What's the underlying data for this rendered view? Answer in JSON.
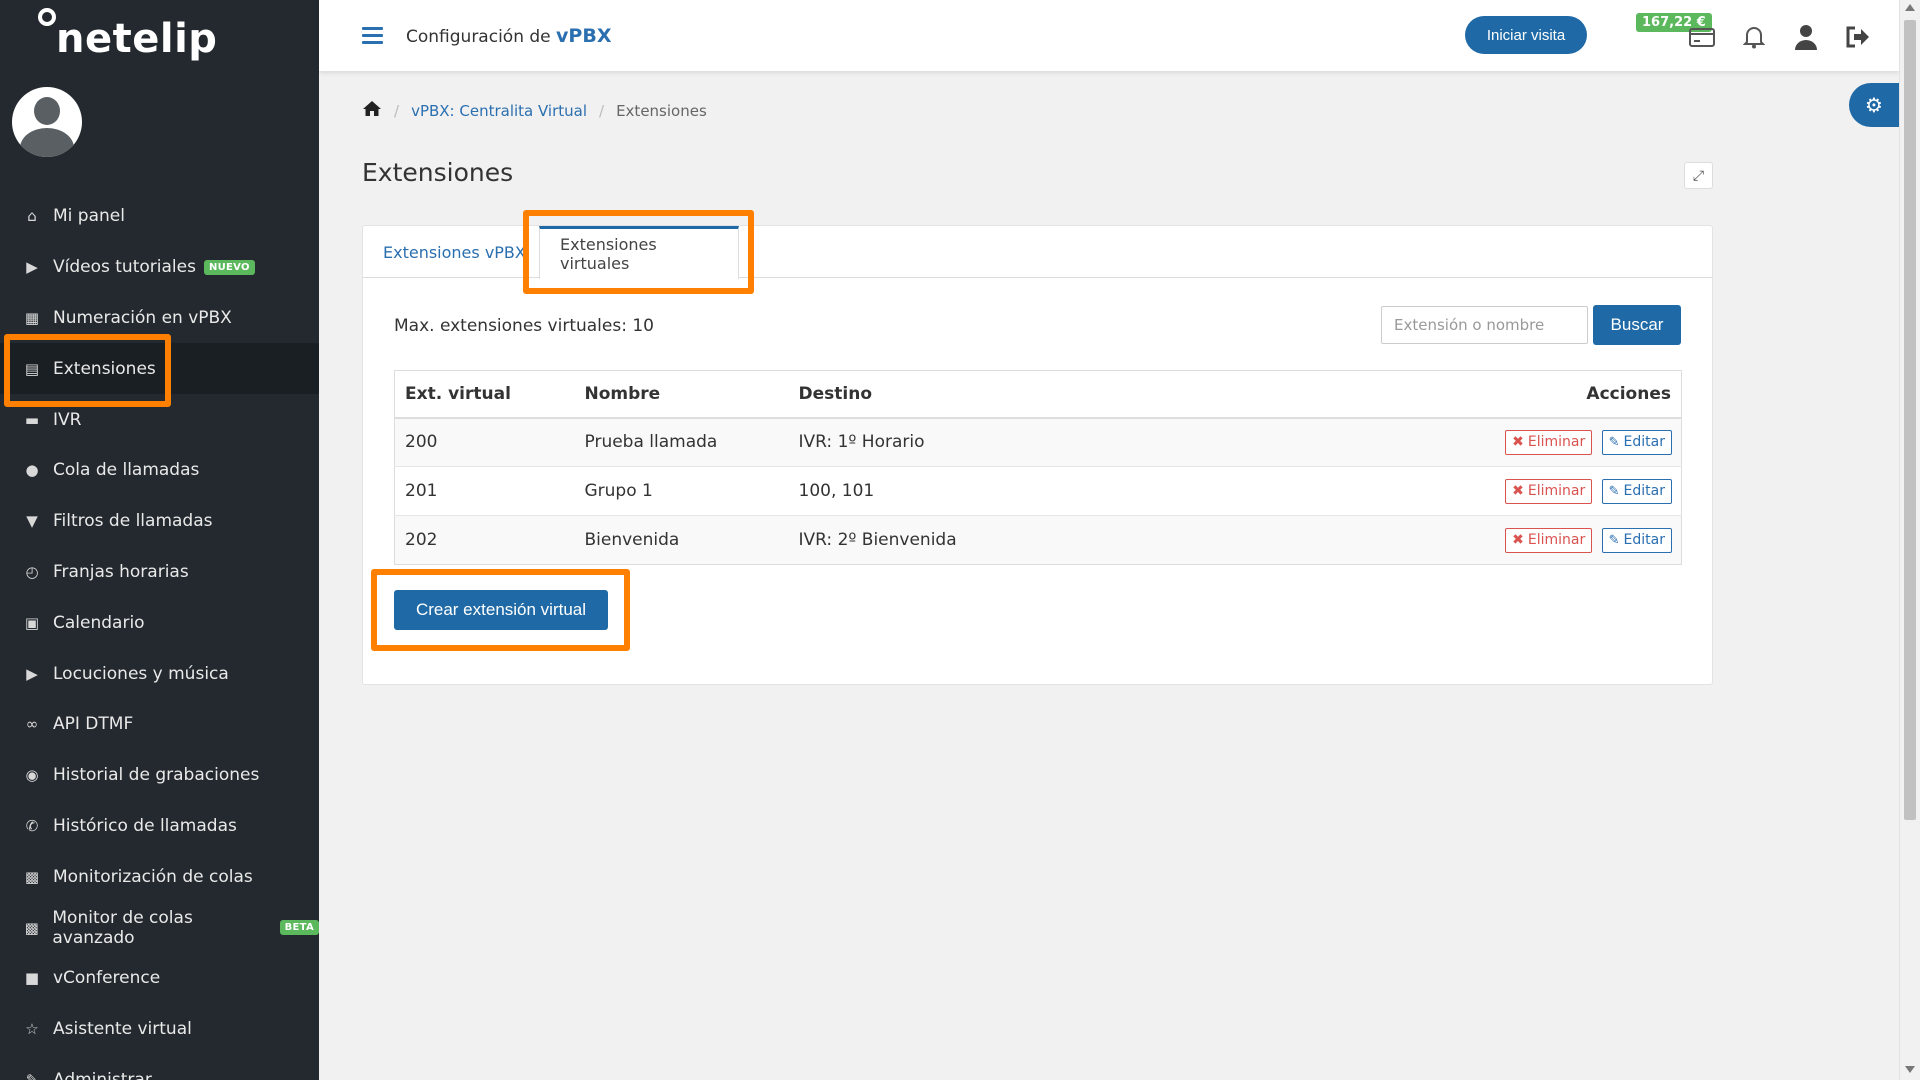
{
  "brand": {
    "logo_text": "netelip"
  },
  "sidebar": {
    "items": [
      {
        "label": "Mi panel",
        "icon": "home-icon"
      },
      {
        "label": "Vídeos tutoriales",
        "icon": "video-icon",
        "badge": "NUEVO"
      },
      {
        "label": "Numeración en vPBX",
        "icon": "grid-icon"
      },
      {
        "label": "Extensiones",
        "icon": "list-icon",
        "active": true
      },
      {
        "label": "IVR",
        "icon": "comment-icon"
      },
      {
        "label": "Cola de llamadas",
        "icon": "user-icon"
      },
      {
        "label": "Filtros de llamadas",
        "icon": "filter-icon"
      },
      {
        "label": "Franjas horarias",
        "icon": "clock-icon"
      },
      {
        "label": "Calendario",
        "icon": "calendar-icon"
      },
      {
        "label": "Locuciones y música",
        "icon": "speaker-icon"
      },
      {
        "label": "API DTMF",
        "icon": "link-icon"
      },
      {
        "label": "Historial de grabaciones",
        "icon": "record-icon"
      },
      {
        "label": "Histórico de llamadas",
        "icon": "phone-icon"
      },
      {
        "label": "Monitorización de colas",
        "icon": "bar-chart-icon"
      },
      {
        "label": "Monitor de colas avanzado",
        "icon": "bar-chart-icon",
        "badge": "BETA"
      },
      {
        "label": "vConference",
        "icon": "camera-icon"
      },
      {
        "label": "Asistente virtual",
        "icon": "star-icon"
      },
      {
        "label": "Administrar",
        "icon": "edit-icon"
      }
    ]
  },
  "topbar": {
    "title_prefix": "Configuración de",
    "title_bold": "vPBX",
    "visit_button": "Iniciar visita",
    "credit": "167,22 €"
  },
  "breadcrumb": {
    "level1": "vPBX: Centralita Virtual",
    "level2": "Extensiones"
  },
  "page": {
    "title": "Extensiones"
  },
  "tabs": {
    "vpbx": "Extensiones vPBX",
    "virtual": "Extensiones virtuales"
  },
  "content": {
    "max_ext": "Max. extensiones virtuales: 10",
    "search_placeholder": "Extensión o nombre",
    "search_button": "Buscar",
    "create_button": "Crear extensión virtual"
  },
  "table": {
    "headers": [
      "Ext. virtual",
      "Nombre",
      "Destino",
      "Acciones"
    ],
    "rows": [
      {
        "ext": "200",
        "nombre": "Prueba llamada",
        "destino": "IVR: 1º Horario"
      },
      {
        "ext": "201",
        "nombre": "Grupo 1",
        "destino": "100, 101"
      },
      {
        "ext": "202",
        "nombre": "Bienvenida",
        "destino": "IVR: 2º Bienvenida"
      }
    ],
    "delete_label": "Eliminar",
    "edit_label": "Editar"
  },
  "colors": {
    "sidebar_bg": "#23292e",
    "primary": "#1f6aa6",
    "highlight": "#ff7f00",
    "danger": "#d9534f",
    "success": "#5cb85c"
  }
}
